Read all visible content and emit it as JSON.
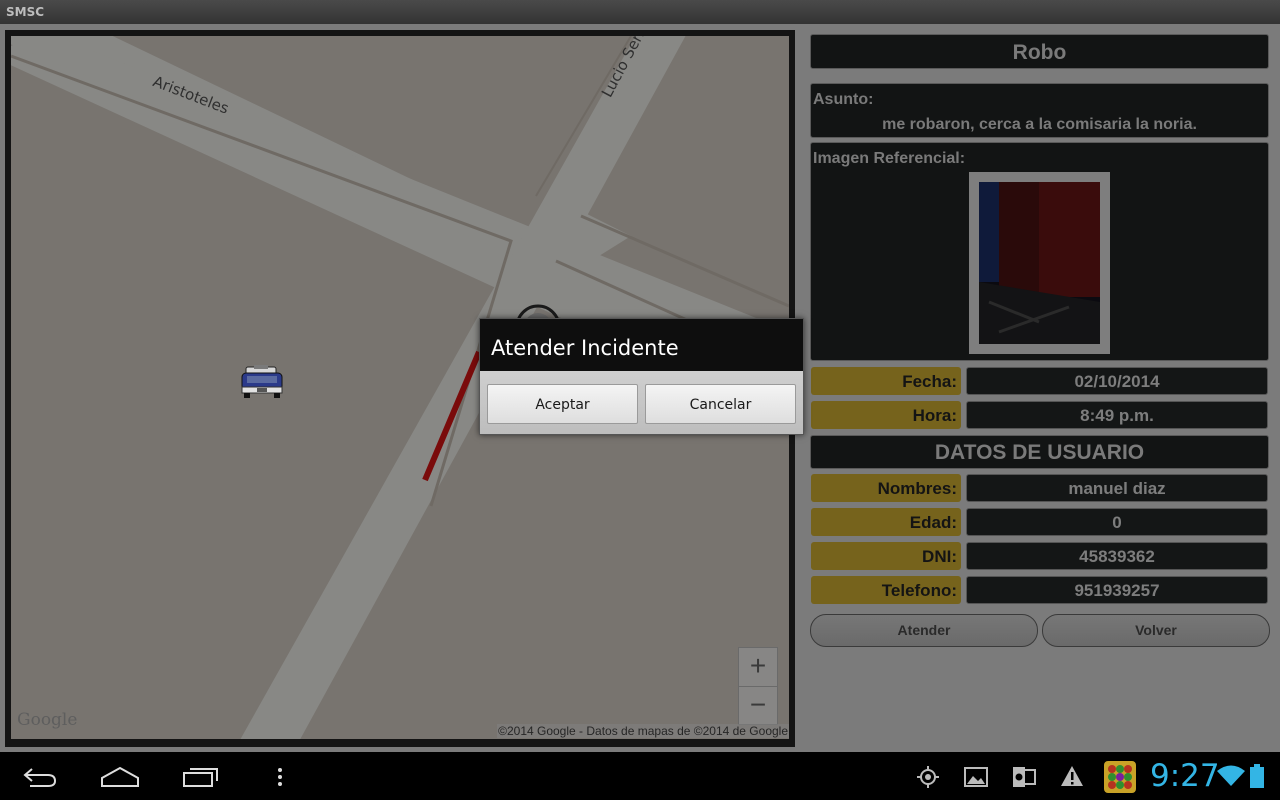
{
  "window": {
    "title": "SMSC"
  },
  "map": {
    "streets": [
      "Aristoteles",
      "Lucio Serr"
    ],
    "zoom_in": "+",
    "zoom_out": "−",
    "logo": "Google",
    "attribution": "©2014 Google - Datos de mapas de ©2014 de Google",
    "icons": [
      "police-car-icon",
      "location-marker-icon"
    ]
  },
  "incident": {
    "title": "Robo",
    "asunto_label": "Asunto:",
    "asunto_value": "me robaron, cerca a la comisaria la noria.",
    "imagen_label": "Imagen Referencial:",
    "fecha_label": "Fecha:",
    "fecha_value": "02/10/2014",
    "hora_label": "Hora:",
    "hora_value": "8:49 p.m."
  },
  "user": {
    "heading": "DATOS DE USUARIO",
    "nombres_label": "Nombres:",
    "nombres_value": "manuel diaz",
    "edad_label": "Edad:",
    "edad_value": "0",
    "dni_label": "DNI:",
    "dni_value": "45839362",
    "telefono_label": "Telefono:",
    "telefono_value": "951939257"
  },
  "actions": {
    "atender": "Atender",
    "volver": "Volver"
  },
  "dialog": {
    "title": "Atender Incidente",
    "accept": "Aceptar",
    "cancel": "Cancelar"
  },
  "navbar": {
    "clock": "9:27",
    "icons": [
      "back-icon",
      "home-icon",
      "recent-apps-icon",
      "menu-icon",
      "gps-icon",
      "gallery-icon",
      "outlook-icon",
      "warning-icon",
      "app-icon",
      "wifi-icon",
      "battery-icon"
    ],
    "accent": "#33b5e5"
  },
  "colors": {
    "label_bg": "#76631c",
    "panel_bg": "#121414",
    "route": "#7a0b0b"
  }
}
